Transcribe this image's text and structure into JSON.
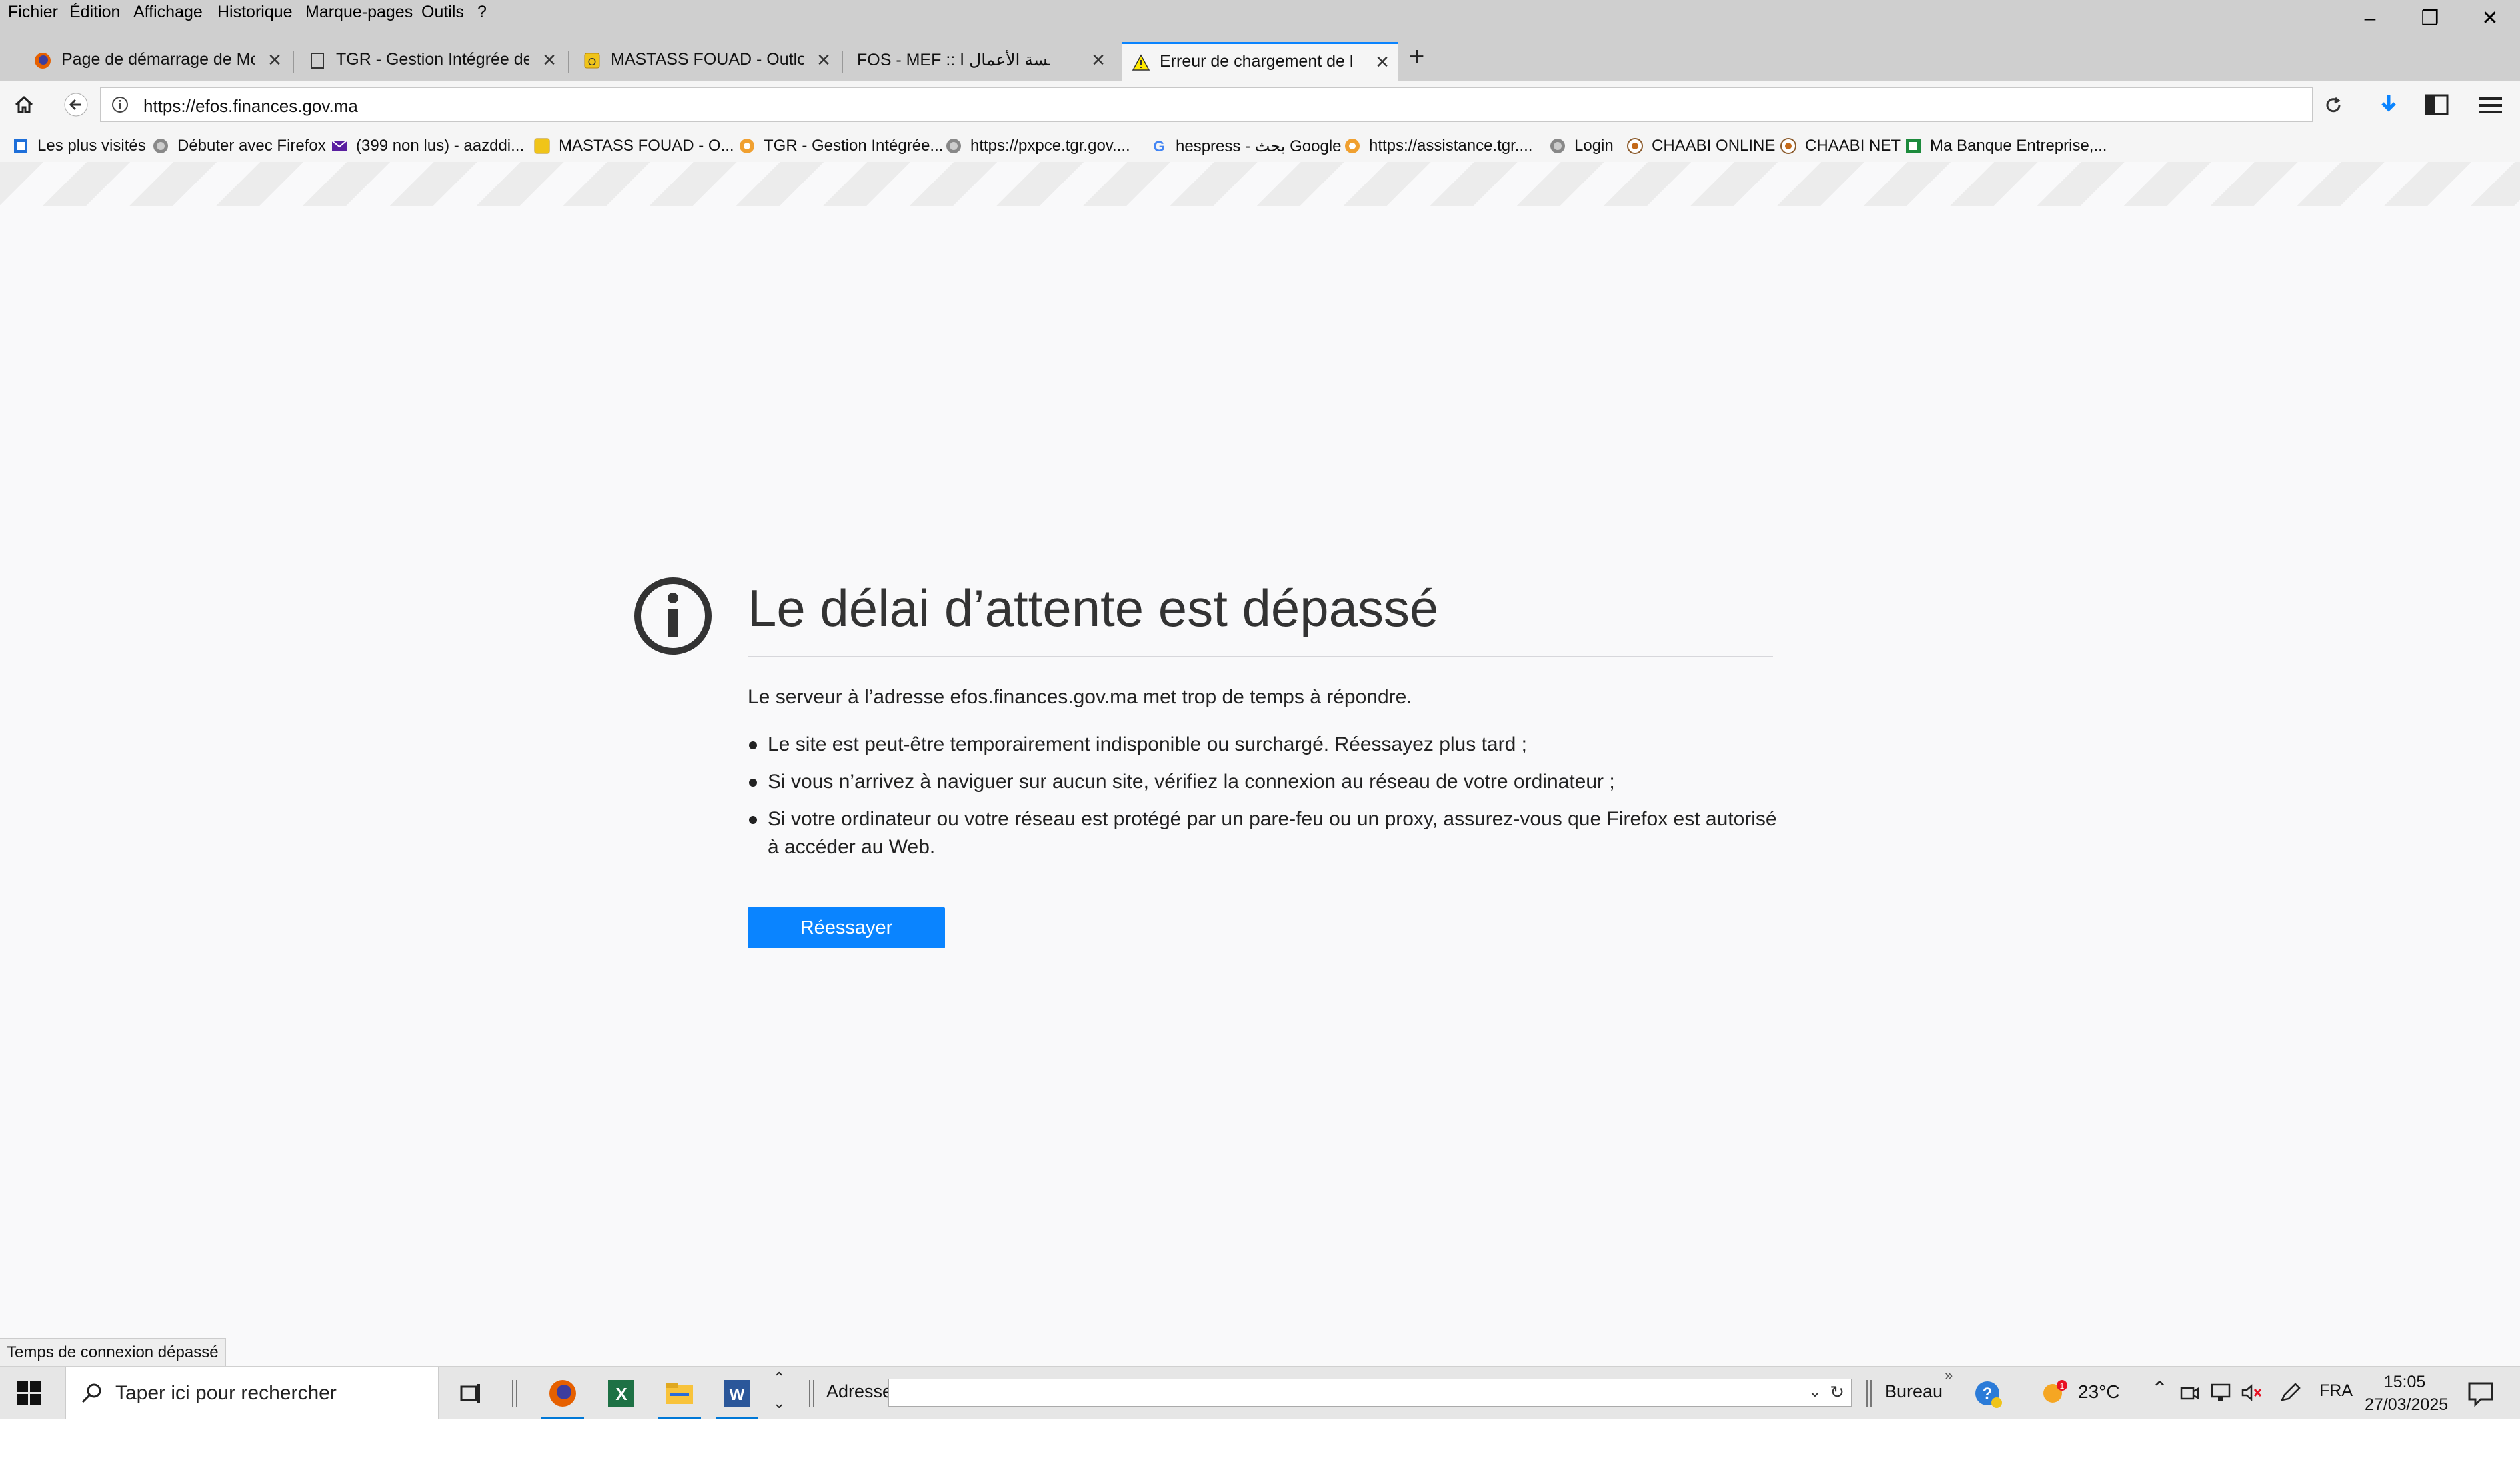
{
  "menu": [
    "Fichier",
    "Édition",
    "Affichage",
    "Historique",
    "Marque-pages",
    "Outils",
    "?"
  ],
  "tabs": [
    {
      "title": "Page de démarrage de Mo...",
      "icon": "firefox-icon",
      "active": false
    },
    {
      "title": "TGR - Gestion Intégrée de ...",
      "icon": "page-icon",
      "active": false
    },
    {
      "title": "MASTASS FOUAD - Outlo...",
      "icon": "outlook-icon",
      "active": false
    },
    {
      "title": "FOS - MEF :: مؤسسة الأعمال ا...",
      "icon": "globe-icon",
      "active": false
    },
    {
      "title": "Erreur de chargement de l...",
      "icon": "warning-icon",
      "active": true
    }
  ],
  "url": "https://efos.finances.gov.ma",
  "bookmarks": [
    {
      "label": "Les plus visités",
      "icon": "bookmark-folder-icon"
    },
    {
      "label": "Débuter avec Firefox",
      "icon": "globe-icon"
    },
    {
      "label": "(399 non lus) - aazddi...",
      "icon": "mail-icon"
    },
    {
      "label": "MASTASS FOUAD - O...",
      "icon": "outlook-icon"
    },
    {
      "label": "TGR - Gestion Intégrée...",
      "icon": "tgr-icon"
    },
    {
      "label": "https://pxpce.tgr.gov....",
      "icon": "globe-icon"
    },
    {
      "label": "hespress - بحث Google",
      "icon": "google-icon"
    },
    {
      "label": "https://assistance.tgr....",
      "icon": "tgr-icon"
    },
    {
      "label": "Login",
      "icon": "globe-icon"
    },
    {
      "label": "CHAABI ONLINE",
      "icon": "chaabi-icon"
    },
    {
      "label": "CHAABI NET",
      "icon": "chaabi-icon"
    },
    {
      "label": "Ma Banque Entreprise,...",
      "icon": "bank-icon"
    }
  ],
  "error": {
    "title": "Le délai d’attente est dépassé",
    "lead": "Le serveur à l’adresse efos.finances.gov.ma met trop de temps à répondre.",
    "items": [
      "Le site est peut-être temporairement indisponible ou surchargé. Réessayez plus tard ;",
      "Si vous n’arrivez à naviguer sur aucun site, vérifiez la connexion au réseau de votre ordinateur ;",
      "Si votre ordinateur ou votre réseau est protégé par un pare-feu ou un proxy, assurez-vous que Firefox est autorisé à accéder au Web."
    ],
    "retry": "Réessayer"
  },
  "status": "Temps de connexion dépassé",
  "taskbar": {
    "search_placeholder": "Taper ici pour rechercher",
    "address_label": "Adresse",
    "bureau": "Bureau",
    "temperature": "23°C",
    "language": "FRA",
    "time": "15:05",
    "date": "27/03/2025"
  },
  "colors": {
    "accent": "#0a84ff",
    "page_bg": "#f9f9fa",
    "chrome": "#cfcfcf"
  }
}
